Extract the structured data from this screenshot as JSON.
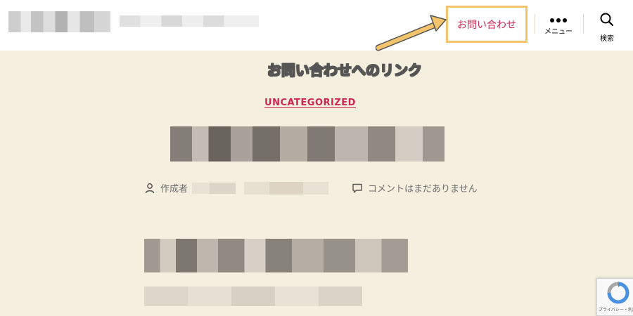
{
  "header": {
    "contact_label": "お問い合わせ",
    "menu_label": "メニュー",
    "search_label": "検索"
  },
  "annotation": {
    "text": "お問い合わせへのリンク"
  },
  "post": {
    "category": "UNCATEGORIZED",
    "author_prefix": "作成者",
    "comments_text": "コメントはまだありません"
  },
  "recaptcha": {
    "text": "プライバシー・利用規約"
  },
  "colors": {
    "accent": "#cd2653",
    "highlight": "#f3c46b",
    "background": "#f5efe0"
  }
}
